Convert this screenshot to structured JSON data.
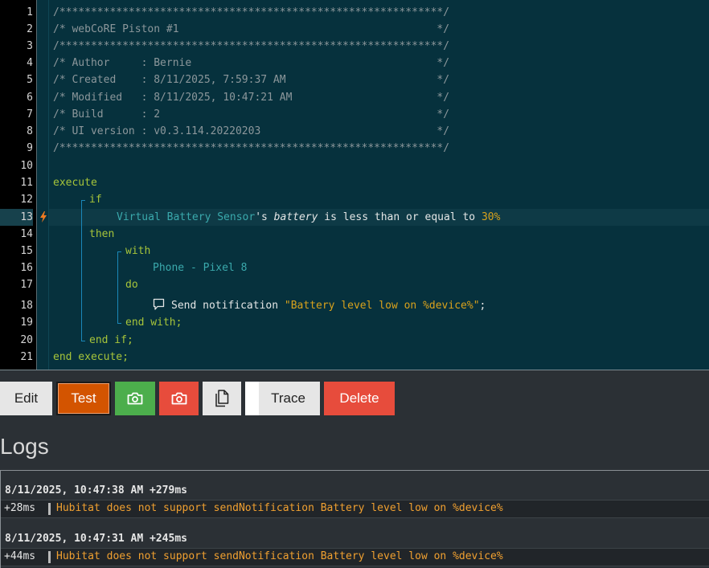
{
  "editor": {
    "line_numbers": [
      "1",
      "2",
      "3",
      "4",
      "5",
      "6",
      "7",
      "8",
      "9",
      "10",
      "11",
      "12",
      "13",
      "14",
      "15",
      "16",
      "17",
      "18",
      "19",
      "20",
      "21"
    ],
    "active_line": "13",
    "lines": {
      "l1": "/*************************************************************/",
      "l2": "/* webCoRE Piston #1                                         */",
      "l3": "/*************************************************************/",
      "l4": "/* Author     : Bernie                                       */",
      "l5": "/* Created    : 8/11/2025, 7:59:37 AM                        */",
      "l6": "/* Modified   : 8/11/2025, 10:47:21 AM                       */",
      "l7": "/* Build      : 2                                            */",
      "l8": "/* UI version : v0.3.114.20220203                            */",
      "l9": "/*************************************************************/",
      "l11": "execute",
      "l12": "if",
      "l13_device": "Virtual Battery Sensor",
      "l13_poss": "'s ",
      "l13_attr": "battery",
      "l13_op": " is less than or equal to ",
      "l13_val": "30",
      "l13_unit": "%",
      "l14": "then",
      "l15": "with",
      "l16": "Phone - Pixel 8",
      "l17": "do",
      "l18_action": "Send notification ",
      "l18_value": "\"Battery level low on %device%\"",
      "l18_end": ";",
      "l19": "end with;",
      "l20": "end if;",
      "l21": "end execute;"
    }
  },
  "toolbar": {
    "edit": "Edit",
    "test": "Test",
    "trace": "Trace",
    "delete": "Delete",
    "icons": [
      "camera-icon",
      "camera-icon",
      "copy-icon"
    ]
  },
  "logs": {
    "title": "Logs",
    "entries": [
      {
        "header": "8/11/2025, 10:47:38 AM +279ms",
        "offset": "+28ms",
        "message": "Hubitat does not support sendNotification Battery level low on %device%"
      },
      {
        "header": "8/11/2025, 10:47:31 AM +245ms",
        "offset": "+44ms",
        "message": "Hubitat does not support sendNotification Battery level low on %device%"
      }
    ]
  },
  "colors": {
    "editor_bg": "#06313d",
    "keyword": "#a6c43a",
    "device": "#3aa9ac",
    "value": "#d9a21c",
    "test": "#d35400",
    "green": "#4cae4c",
    "red": "#e74c3c",
    "log_message": "#f0a030"
  }
}
